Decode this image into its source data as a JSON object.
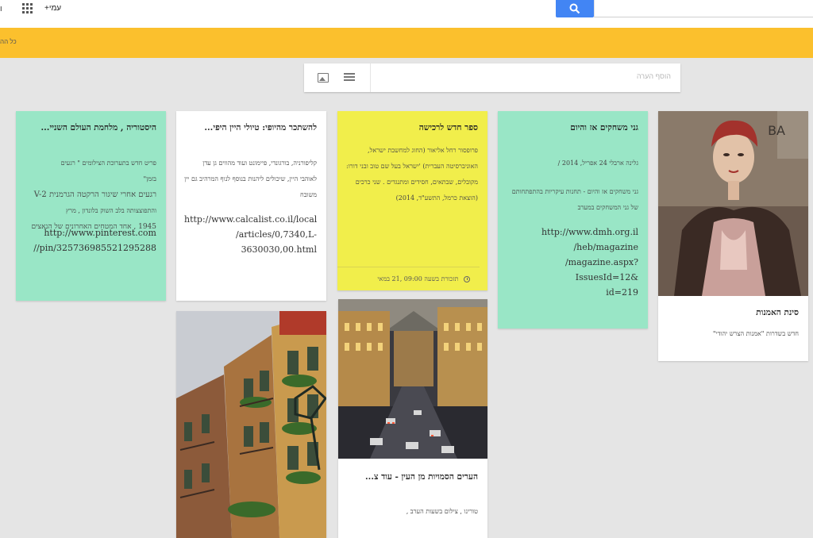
{
  "topbar": {
    "edge_mark": "ו",
    "plus_me": "+עמי",
    "search_value": ""
  },
  "banner": {
    "text": "כל הה"
  },
  "add_note": {
    "placeholder": "הוסף הערה"
  },
  "cards": {
    "art_cinema": {
      "title": "סינת האמנות",
      "text": "חדש בשדרות \"אמנות הצרש יהודי\""
    },
    "games": {
      "title": "גני משחקים אז והיום",
      "author_line": "גלינה ארבלי       24 אפריל, 2014 /",
      "body": "גני משחקים אז והיום - תחנות עיקריות בהתפתחותם של גני המשחקים במערב",
      "url_lines": [
        "http://www.dmh.org.il",
        "/heb/magazine",
        "/magazine.aspx?IssuesId=12&",
        "id=219"
      ]
    },
    "new_book": {
      "title": "ספר חדש לרכישה",
      "body": "פרופסור רחל אליאור (החוג למחשבת ישראל, האוניברסיטה העברית) 'ישראל בעל שם טוב ובני דורו: מקובלים, שבתאים, חסידים ומתנגדים . שני כרכים (הוצאת כרמל, התשע\"ד, 2014)",
      "reminder": "תזכורת בשעה 09:00 ,21 במאי"
    },
    "wine": {
      "title": "להשתכר מהיופי: טיולי היין היפי...",
      "body": "קליפורניה, בורגונדי, פיימונט ועוד מהווים גן עדן לאוהבי היין, שיכולים ליהנות בנוסף לנוף המרהיב גם יין משובח",
      "url_lines": [
        "http://www.calcalist.co.il/local",
        "/articles/0,7340,L-",
        "3630030,00.html"
      ]
    },
    "history": {
      "title": "היסטוריה , מלחמת העולם השניי...",
      "body_lines": [
        "פריט חדש בתערוכת הצילומים \" רגעים",
        "בזמן\"",
        "רגעים אחרי שיגור הרקטה הגרמנית V-2",
        "והתפוצצותה בלב השוק בלונדון , מרץ",
        "1945 , אחד המטחים האחרונים של הנאצים"
      ],
      "url_lines": [
        "http://www.pinterest.com",
        "//pin/325736985521295288"
      ]
    },
    "cities": {
      "title": "הערים הסמויות מן העין - עוד צ...",
      "text": "טורינו , צילום בשעות הערב ,"
    }
  },
  "colors": {
    "banner": "#fbc02d",
    "teal_card": "#99e6c6",
    "yellow_card": "#f1ee4b",
    "search_button": "#4285f4",
    "background": "#e5e5e5"
  }
}
